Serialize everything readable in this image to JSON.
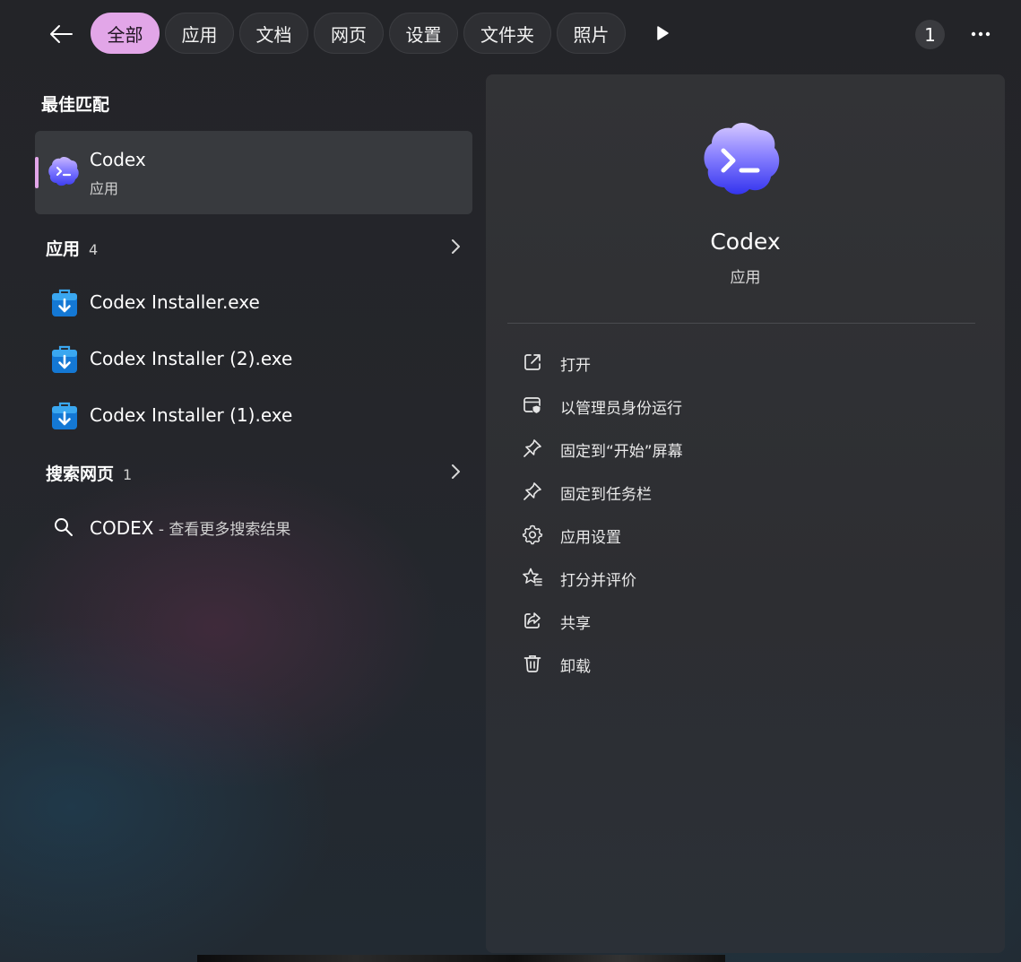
{
  "filters": [
    {
      "label": "全部",
      "active": true
    },
    {
      "label": "应用",
      "active": false
    },
    {
      "label": "文档",
      "active": false
    },
    {
      "label": "网页",
      "active": false
    },
    {
      "label": "设置",
      "active": false
    },
    {
      "label": "文件夹",
      "active": false
    },
    {
      "label": "照片",
      "active": false
    }
  ],
  "topbar": {
    "badge_count": "1"
  },
  "best_match": {
    "heading": "最佳匹配",
    "name": "Codex",
    "type": "应用"
  },
  "apps": {
    "heading": "应用",
    "count": "4",
    "items": [
      {
        "label": "Codex Installer.exe"
      },
      {
        "label": "Codex Installer (2).exe"
      },
      {
        "label": "Codex Installer (1).exe"
      }
    ]
  },
  "web": {
    "heading": "搜索网页",
    "count": "1",
    "query": "CODEX",
    "suffix": " - 查看更多搜索结果"
  },
  "detail": {
    "name": "Codex",
    "type": "应用",
    "actions": [
      {
        "label": "打开",
        "icon": "open-external-icon"
      },
      {
        "label": "以管理员身份运行",
        "icon": "run-as-admin-icon"
      },
      {
        "label": "固定到“开始”屏幕",
        "icon": "pin-icon"
      },
      {
        "label": "固定到任务栏",
        "icon": "pin-icon"
      },
      {
        "label": "应用设置",
        "icon": "gear-icon"
      },
      {
        "label": "打分并评价",
        "icon": "rate-star-icon"
      },
      {
        "label": "共享",
        "icon": "share-icon"
      },
      {
        "label": "卸载",
        "icon": "trash-icon"
      }
    ]
  },
  "colors": {
    "accent": "#e2a6e8",
    "panel": "#2f3034",
    "selected": "#383a3e"
  }
}
